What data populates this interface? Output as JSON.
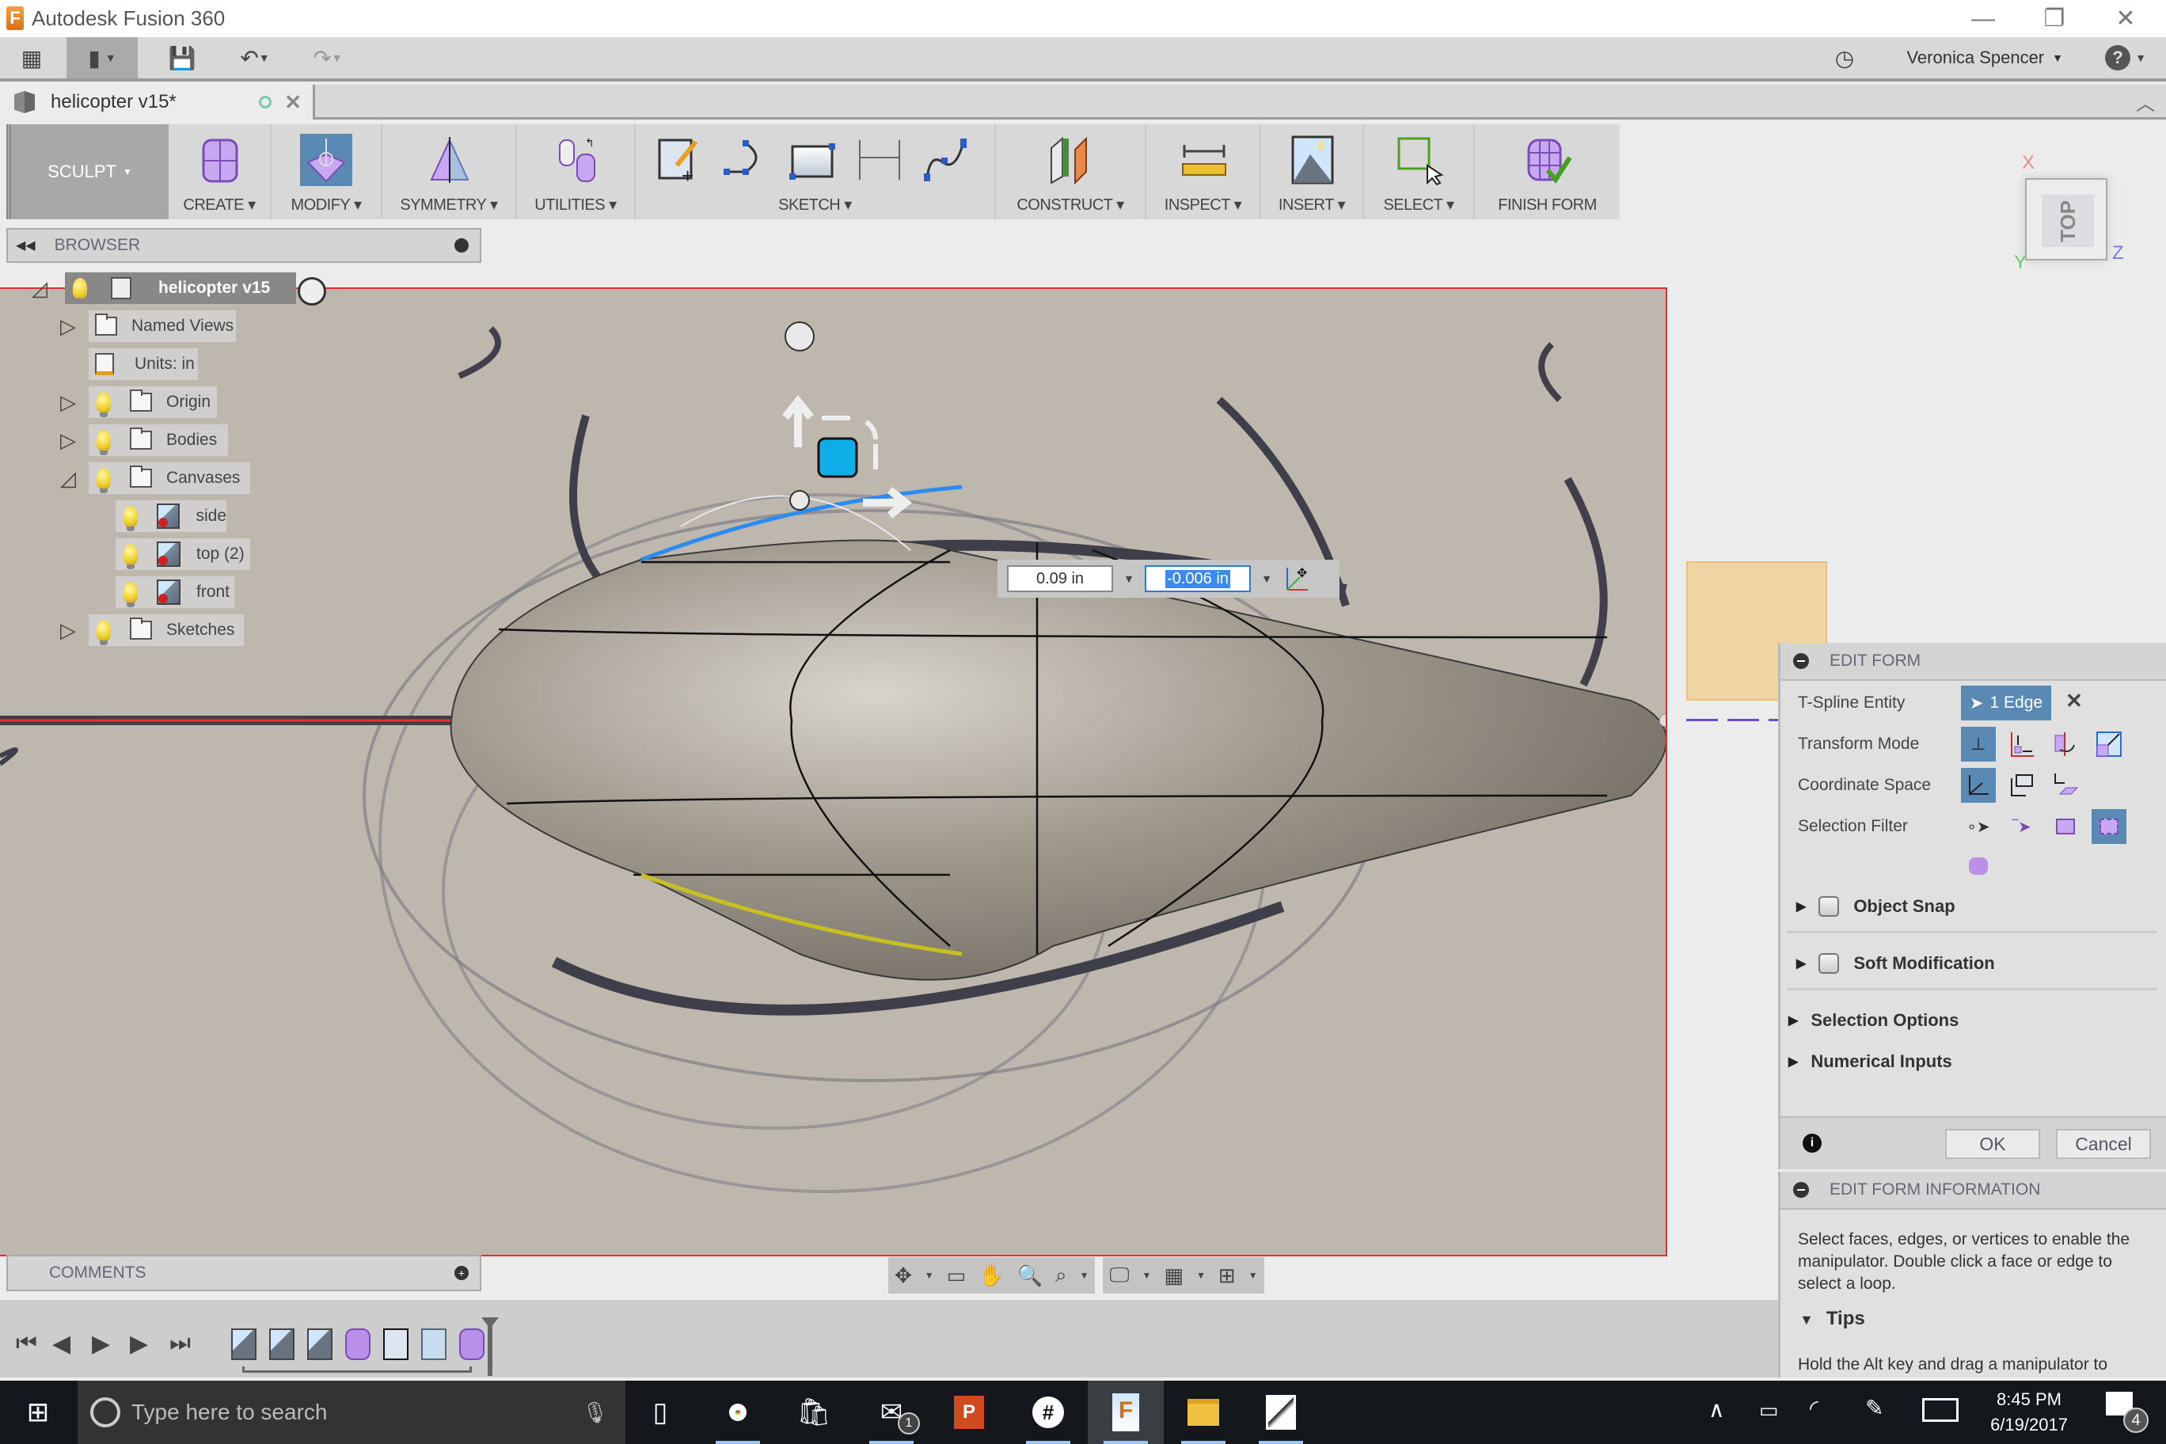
{
  "window": {
    "app_title": "Autodesk Fusion 360",
    "logo_letter": "F"
  },
  "app_toolbar": {
    "user_name": "Veronica Spencer",
    "icons": [
      "apps-grid-icon",
      "file-icon",
      "save-icon",
      "undo-icon",
      "redo-icon",
      "job-status-icon",
      "help-icon"
    ]
  },
  "document_tab": {
    "name": "helicopter v15*"
  },
  "ribbon": {
    "workspace": "SCULPT",
    "groups": [
      {
        "label": "CREATE"
      },
      {
        "label": "MODIFY"
      },
      {
        "label": "SYMMETRY"
      },
      {
        "label": "UTILITIES"
      },
      {
        "label": "SKETCH"
      },
      {
        "label": "CONSTRUCT"
      },
      {
        "label": "INSPECT"
      },
      {
        "label": "INSERT"
      },
      {
        "label": "SELECT"
      },
      {
        "label": "FINISH FORM"
      }
    ]
  },
  "browser": {
    "title": "BROWSER",
    "root": "helicopter v15",
    "items": [
      {
        "label": "Named Views",
        "type": "folder",
        "expandable": true
      },
      {
        "label": "Units: in",
        "type": "units"
      },
      {
        "label": "Origin",
        "type": "folder",
        "expandable": true
      },
      {
        "label": "Bodies",
        "type": "folder",
        "expandable": true
      },
      {
        "label": "Canvases",
        "type": "folder",
        "expanded": true
      },
      {
        "label": "side",
        "type": "canvas"
      },
      {
        "label": "top (2)",
        "type": "canvas"
      },
      {
        "label": "front",
        "type": "canvas"
      },
      {
        "label": "Sketches",
        "type": "folder",
        "expandable": true
      }
    ]
  },
  "viewport": {
    "numeric_input_1": "0.09 in",
    "numeric_input_2": "-0.006 in",
    "viewcube": {
      "face": "TOP",
      "axis_x": "X",
      "axis_y": "Y",
      "axis_z": "Z"
    },
    "colors": {
      "selected_edge": "#2a8cf0",
      "hover_edge": "#c8c020",
      "axis_red": "#e83030",
      "manipulator_blue": "#10aee8"
    }
  },
  "edit_form": {
    "title": "EDIT FORM",
    "tspline_entity_label": "T-Spline Entity",
    "tspline_entity_value": "1 Edge",
    "transform_mode_label": "Transform Mode",
    "coordinate_space_label": "Coordinate Space",
    "selection_filter_label": "Selection Filter",
    "object_snap": {
      "label": "Object Snap",
      "checked": false
    },
    "soft_modification": {
      "label": "Soft Modification",
      "checked": false
    },
    "selection_options": "Selection Options",
    "numerical_inputs": "Numerical Inputs",
    "ok": "OK",
    "cancel": "Cancel"
  },
  "edit_form_info": {
    "title": "EDIT FORM INFORMATION",
    "description": "Select faces, edges, or vertices to enable the manipulator. Double click a face or edge to select a loop.",
    "tips_label": "Tips",
    "tip_text": "Hold the Alt key and drag a manipulator to"
  },
  "comments": {
    "title": "COMMENTS"
  },
  "taskbar": {
    "search_placeholder": "Type here to search",
    "time": "8:45 PM",
    "date": "6/19/2017",
    "mail_badge": "1",
    "notification_count": "4"
  }
}
